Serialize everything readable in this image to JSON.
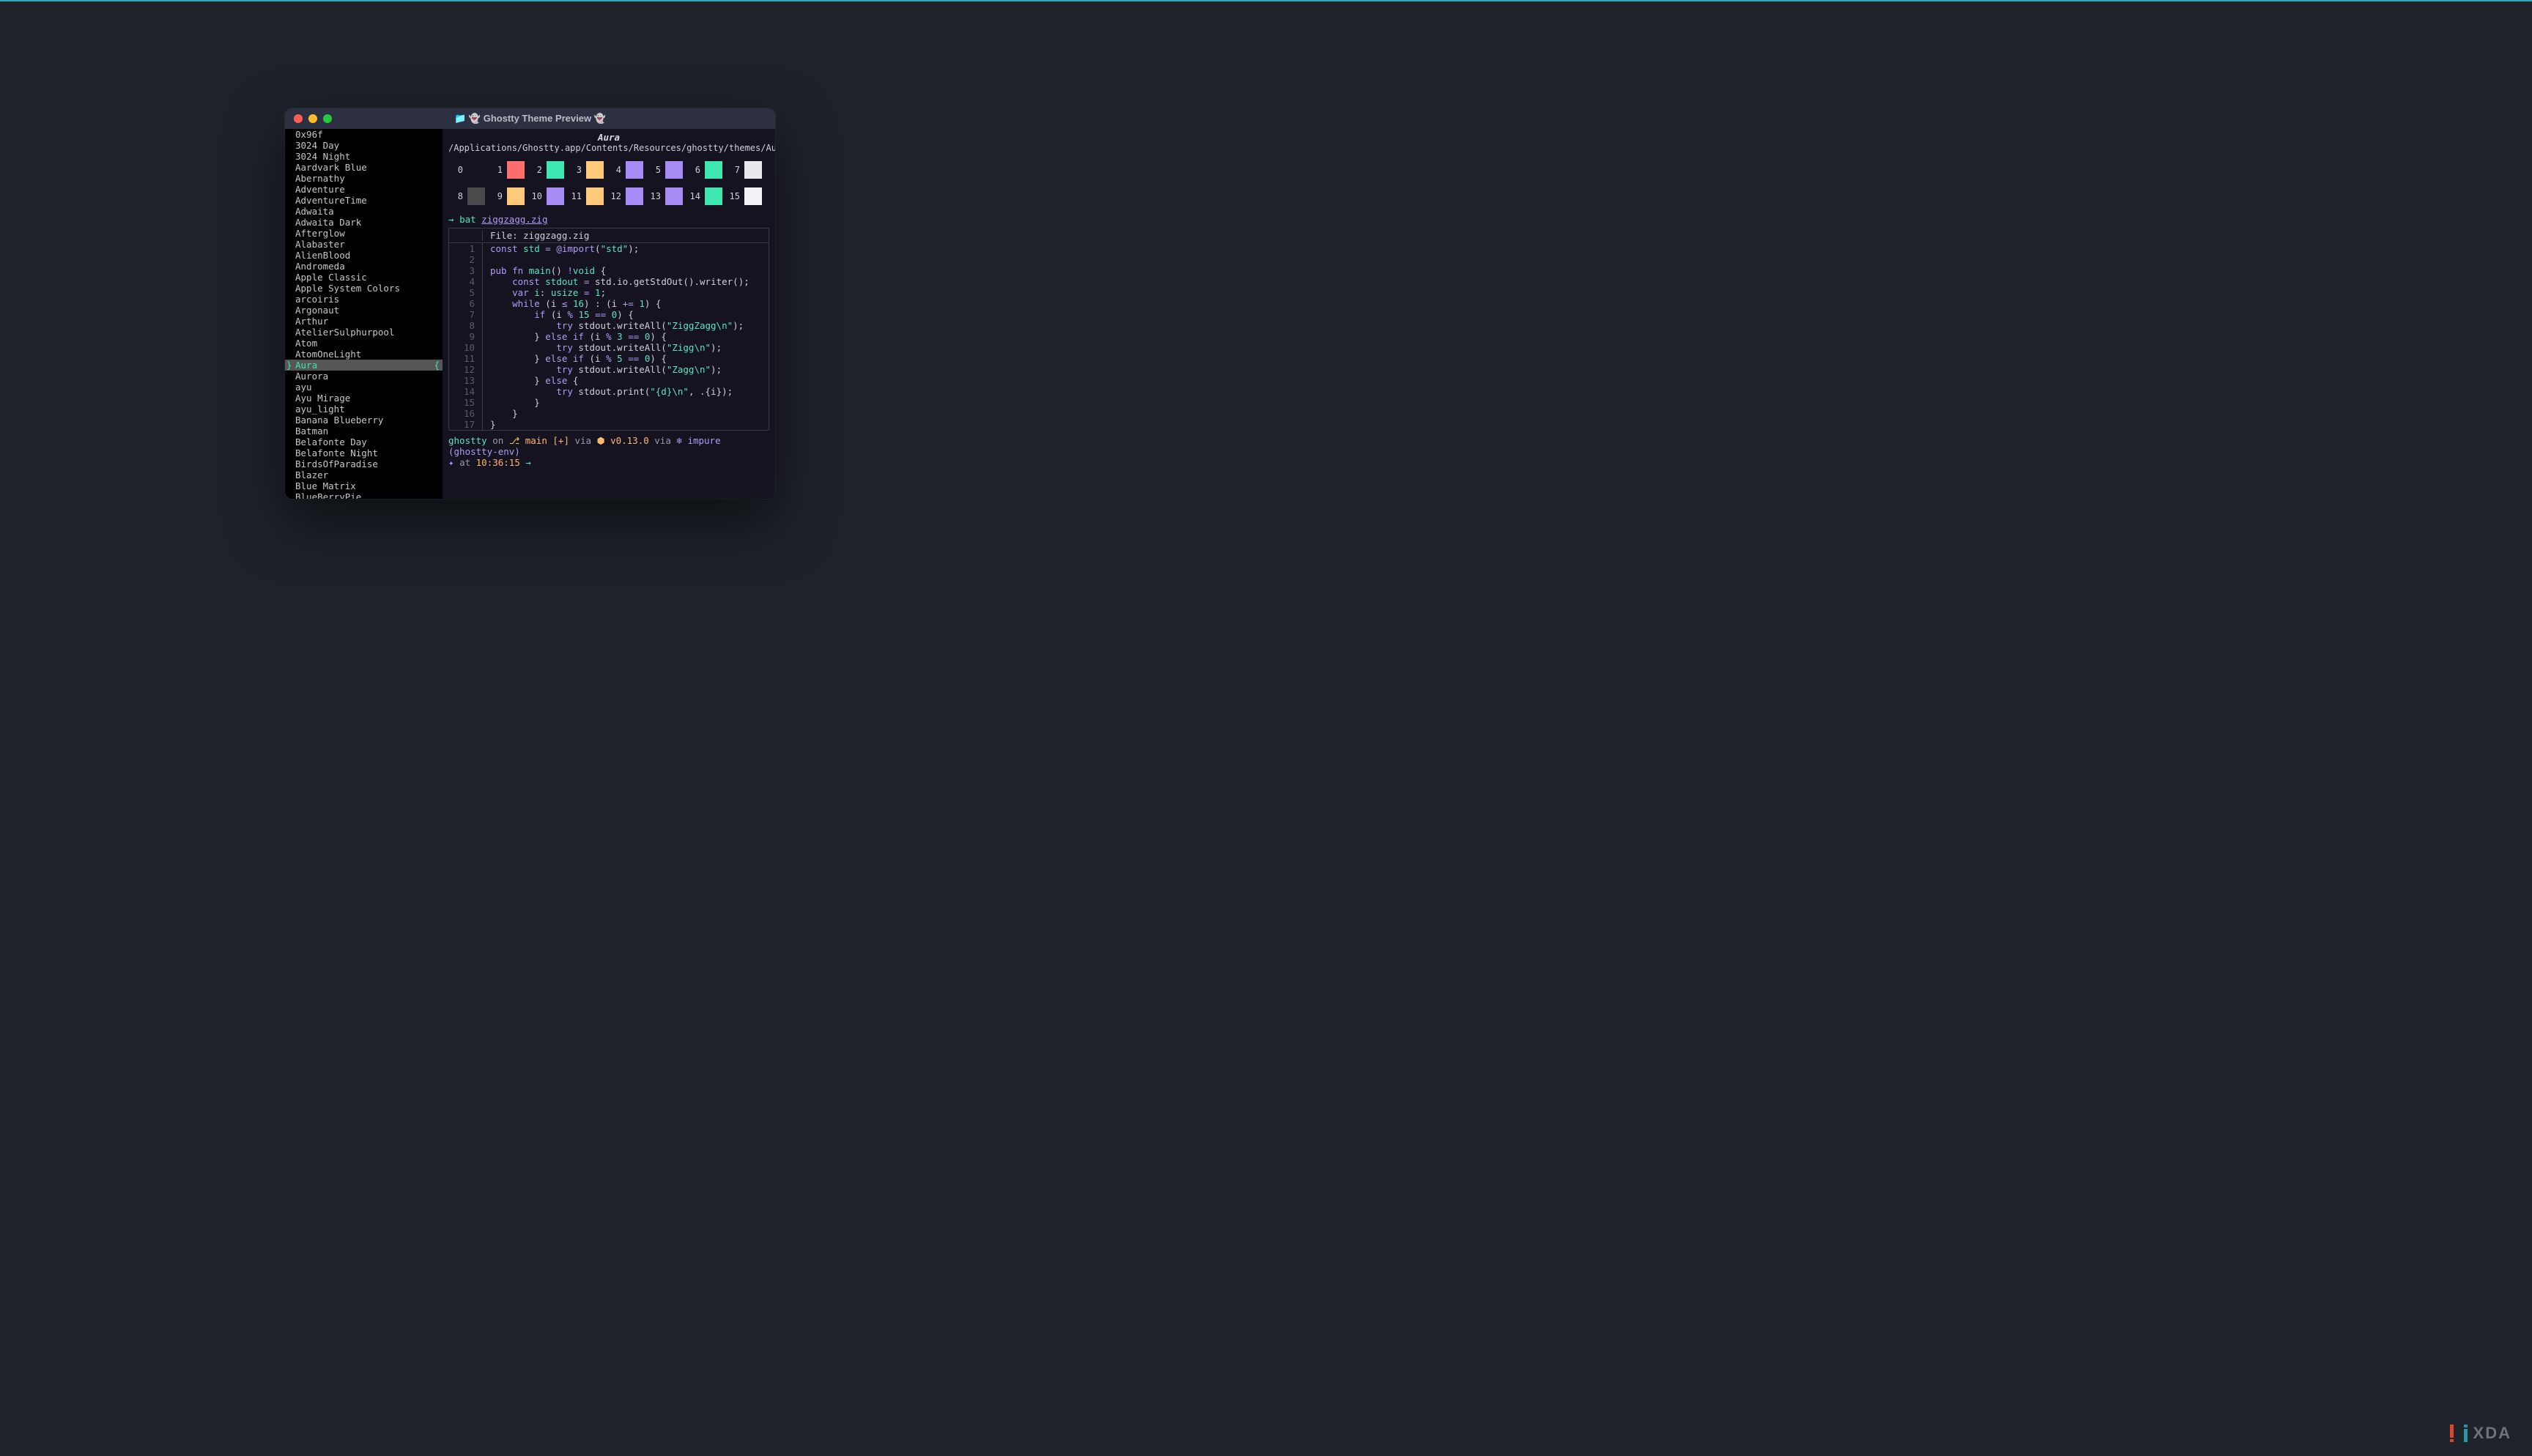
{
  "window": {
    "title": "👻 Ghostty Theme Preview 👻",
    "title_prefix_icon": "📁"
  },
  "themes": [
    "0x96f",
    "3024 Day",
    "3024 Night",
    "Aardvark Blue",
    "Abernathy",
    "Adventure",
    "AdventureTime",
    "Adwaita",
    "Adwaita Dark",
    "Afterglow",
    "Alabaster",
    "AlienBlood",
    "Andromeda",
    "Apple Classic",
    "Apple System Colors",
    "arcoiris",
    "Argonaut",
    "Arthur",
    "AtelierSulphurpool",
    "Atom",
    "AtomOneLight",
    "Aura",
    "Aurora",
    "ayu",
    "Ayu Mirage",
    "ayu_light",
    "Banana Blueberry",
    "Batman",
    "Belafonte Day",
    "Belafonte Night",
    "BirdsOfParadise",
    "Blazer",
    "Blue Matrix",
    "BlueBerryPie"
  ],
  "selected_index": 21,
  "preview": {
    "theme_name": "Aura",
    "theme_path": "/Applications/Ghostty.app/Contents/Resources/ghostty/themes/Aura",
    "palette": [
      [
        "#14131f",
        "#ff6d6d",
        "#3ee6b1",
        "#ffc97a",
        "#a88cf5",
        "#a88cf5",
        "#3ee6b1",
        "#e8e8ee"
      ],
      [
        "#4a4a4a",
        "#ffc97a",
        "#a88cf5",
        "#ffc97a",
        "#a88cf5",
        "#a88cf5",
        "#3ee6b1",
        "#f2f2f6"
      ]
    ],
    "command": {
      "prompt_symbol": "→",
      "cmd": "bat",
      "arg": "ziggzagg.zig"
    },
    "file_header": "File: ziggzagg.zig",
    "code_lines": [
      {
        "n": 1,
        "html": "<span class='kw'>const</span> <span class='ty'>std</span> <span class='op'>=</span> <span class='kw'>@import</span><span class='punc'>(</span><span class='str'>\"std\"</span><span class='punc'>);</span>"
      },
      {
        "n": 2,
        "html": ""
      },
      {
        "n": 3,
        "html": "<span class='kw'>pub fn</span> <span class='fn'>main</span><span class='punc'>()</span> <span class='op'>!</span><span class='ty'>void</span> <span class='punc'>{</span>"
      },
      {
        "n": 4,
        "html": "    <span class='kw'>const</span> <span class='ty'>stdout</span> <span class='op'>=</span> std.io.getStdOut().writer();"
      },
      {
        "n": 5,
        "html": "    <span class='kw'>var</span> <span class='ty'>i</span><span class='punc'>:</span> <span class='ty'>usize</span> <span class='op'>=</span> <span class='num'>1</span><span class='punc'>;</span>"
      },
      {
        "n": 6,
        "html": "    <span class='kw'>while</span> <span class='punc'>(</span>i <span class='op'>&le;</span> <span class='num'>16</span><span class='punc'>)</span> <span class='punc'>:</span> <span class='punc'>(</span>i <span class='op'>+=</span> <span class='num'>1</span><span class='punc'>)</span> <span class='punc'>{</span>"
      },
      {
        "n": 7,
        "html": "        <span class='kw'>if</span> <span class='punc'>(</span>i <span class='op'>%</span> <span class='num'>15</span> <span class='op'>==</span> <span class='num'>0</span><span class='punc'>)</span> <span class='punc'>{</span>"
      },
      {
        "n": 8,
        "html": "            <span class='kw'>try</span> stdout.writeAll(<span class='str'>\"ZiggZagg\\n\"</span>);"
      },
      {
        "n": 9,
        "html": "        <span class='punc'>}</span> <span class='kw'>else if</span> <span class='punc'>(</span>i <span class='op'>%</span> <span class='num'>3</span> <span class='op'>==</span> <span class='num'>0</span><span class='punc'>)</span> <span class='punc'>{</span>"
      },
      {
        "n": 10,
        "html": "            <span class='kw'>try</span> stdout.writeAll(<span class='str'>\"Zigg\\n\"</span>);"
      },
      {
        "n": 11,
        "html": "        <span class='punc'>}</span> <span class='kw'>else if</span> <span class='punc'>(</span>i <span class='op'>%</span> <span class='num'>5</span> <span class='op'>==</span> <span class='num'>0</span><span class='punc'>)</span> <span class='punc'>{</span>"
      },
      {
        "n": 12,
        "html": "            <span class='kw'>try</span> stdout.writeAll(<span class='str'>\"Zagg\\n\"</span>);"
      },
      {
        "n": 13,
        "html": "        <span class='punc'>}</span> <span class='kw'>else</span> <span class='punc'>{</span>"
      },
      {
        "n": 14,
        "html": "            <span class='kw'>try</span> stdout.print(<span class='str'>\"{d}\\n\"</span>, .{i});"
      },
      {
        "n": 15,
        "html": "        <span class='punc'>}</span>"
      },
      {
        "n": 16,
        "html": "    <span class='punc'>}</span>"
      },
      {
        "n": 17,
        "html": "<span class='punc'>}</span>"
      }
    ],
    "status": {
      "project": "ghostty",
      "on": "on",
      "branch_icon": "⎇",
      "branch": "main",
      "plus": "[+]",
      "via1": "via",
      "ver_icon": "⬢",
      "version": "v0.13.0",
      "via2": "via",
      "env_icon": "❄",
      "env": "impure (ghostty-env)",
      "star": "✦",
      "at": "at",
      "time": "10:36:15",
      "arrow": "→"
    }
  },
  "watermark": {
    "text": "XDA"
  }
}
